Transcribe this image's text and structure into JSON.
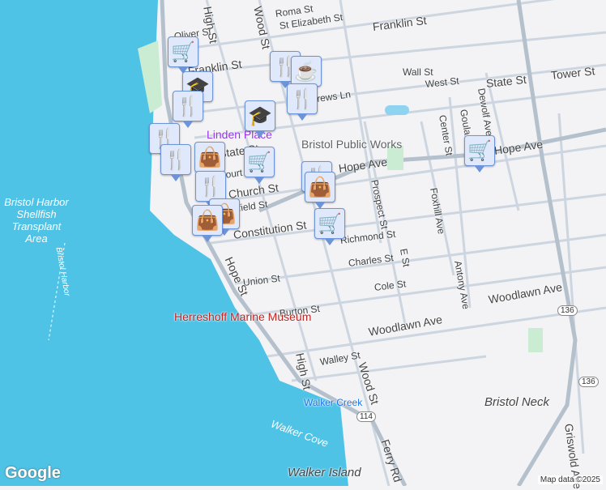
{
  "colors": {
    "water": "#4fc3e6",
    "road": "#c9d3de",
    "major": "#a9b6c4",
    "pin_fill": "#dfe9fb",
    "pin_icon": "#0b4566",
    "park": "#c9ecd2"
  },
  "streets": {
    "roma": "Roma St",
    "st_elizabeth": "St Elizabeth St",
    "franklin_e": "Franklin St",
    "franklin_w": "Franklin St",
    "oliver": "Oliver St",
    "high_n": "High St",
    "wood_n": "Wood St",
    "wall": "Wall St",
    "west": "West St",
    "state_e": "State St",
    "tower": "Tower St",
    "andrews": "Andrews Ln",
    "linden": "Linden Place",
    "bristol_works": "Bristol Public Works",
    "center": "Center St",
    "goulart": "Goulart Ave",
    "dewolf": "Dewolf Ave",
    "hope_e": "Hope Ave",
    "hope_mid": "Hope Ave",
    "state_w": "State St",
    "court": "Court St",
    "church": "Church St",
    "byfield": "Byfield St",
    "prospect": "Prospect St",
    "foxhill": "Foxhill Ave",
    "constitution": "Constitution St",
    "richmond": "Richmond St",
    "e_st": "E St",
    "charles": "Charles St",
    "antony": "Antony Ave",
    "union": "Union St",
    "hope_s": "Hope St",
    "cole": "Cole St",
    "woodlawn_w": "Woodlawn Ave",
    "woodlawn_e": "Woodlawn Ave",
    "burton": "Burton St",
    "high_s": "High St",
    "walley": "Walley St",
    "wood_s": "Wood St",
    "ferry": "Ferry Rd",
    "griswold": "Griswold Ave",
    "bristol_neck": "Bristol Neck",
    "walker_creek": "Walker Creek",
    "walker_cove": "Walker Cove",
    "walker_island": "Walker Island",
    "harbor_area": "Bristol Harbor Shellfish Transplant Area",
    "bristol_harbor": "Bristol Harbor",
    "museum": "Herreshoff Marine Museum"
  },
  "shields": {
    "r136a": "136",
    "r136b": "136",
    "r114": "114"
  },
  "brand": "Google",
  "credit": "Map data ©2025"
}
